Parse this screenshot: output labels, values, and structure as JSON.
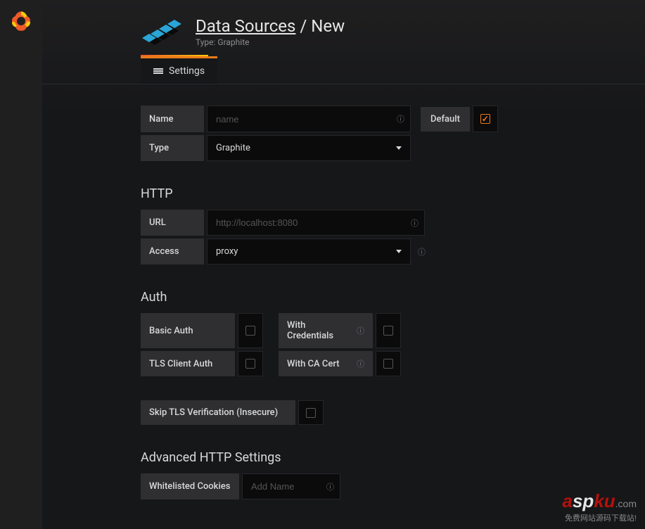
{
  "breadcrumb": {
    "link": "Data Sources",
    "current": "New"
  },
  "subtitle": "Type: Graphite",
  "tab": {
    "label": "Settings"
  },
  "fields": {
    "name_label": "Name",
    "name_placeholder": "name",
    "type_label": "Type",
    "type_value": "Graphite",
    "default_label": "Default",
    "default_checked": true
  },
  "http": {
    "section": "HTTP",
    "url_label": "URL",
    "url_placeholder": "http://localhost:8080",
    "access_label": "Access",
    "access_value": "proxy"
  },
  "auth": {
    "section": "Auth",
    "basic": "Basic Auth",
    "with_credentials": "With Credentials",
    "tls_client": "TLS Client Auth",
    "with_ca_cert": "With CA Cert",
    "skip_tls": "Skip TLS Verification (Insecure)"
  },
  "advanced": {
    "section": "Advanced HTTP Settings",
    "whitelisted_label": "Whitelisted Cookies",
    "add_placeholder": "Add Name"
  },
  "watermark": {
    "a": "a",
    "s": "s",
    "p": "p",
    "ku": "ku",
    "com": ".com",
    "sub": "免费网站源码下载站!"
  }
}
